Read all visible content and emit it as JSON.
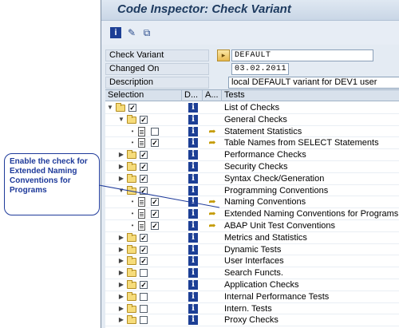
{
  "window": {
    "title": "Code Inspector: Check Variant"
  },
  "toolbar": [
    {
      "name": "info-icon",
      "glyph": "i"
    },
    {
      "name": "edit-pen-icon",
      "glyph": "✎"
    },
    {
      "name": "structure-icon",
      "glyph": "⧉"
    }
  ],
  "form": {
    "check_variant_label": "Check Variant",
    "check_variant_value": "DEFAULT",
    "changed_on_label": "Changed On",
    "changed_on_value": "03.02.2011",
    "description_label": "Description",
    "description_value": "local DEFAULT variant for DEV1 user"
  },
  "columns": {
    "selection": "Selection",
    "d": "D...",
    "a": "A...",
    "tests": "Tests"
  },
  "tree": [
    {
      "label": "List of Checks",
      "level": 0,
      "type": "folder",
      "checked": true,
      "expander": "▼",
      "run": false
    },
    {
      "label": "General Checks",
      "level": 1,
      "type": "folder-open",
      "checked": true,
      "expander": "▼",
      "run": false
    },
    {
      "label": "Statement Statistics",
      "level": 2,
      "type": "doc",
      "checked": false,
      "expander": "•",
      "run": true
    },
    {
      "label": "Table Names from SELECT Statements",
      "level": 2,
      "type": "doc",
      "checked": true,
      "expander": "•",
      "run": true
    },
    {
      "label": "Performance Checks",
      "level": 1,
      "type": "folder",
      "checked": true,
      "expander": "▶",
      "run": false
    },
    {
      "label": "Security Checks",
      "level": 1,
      "type": "folder",
      "checked": true,
      "expander": "▶",
      "run": false
    },
    {
      "label": "Syntax Check/Generation",
      "level": 1,
      "type": "folder",
      "checked": true,
      "expander": "▶",
      "run": false
    },
    {
      "label": "Programming Conventions",
      "level": 1,
      "type": "folder",
      "checked": true,
      "expander": "▼",
      "run": false
    },
    {
      "label": "Naming Conventions",
      "level": 2,
      "type": "doc",
      "checked": true,
      "expander": "•",
      "run": true
    },
    {
      "label": "Extended Naming Conventions for Programs",
      "level": 2,
      "type": "doc",
      "checked": true,
      "expander": "•",
      "run": true
    },
    {
      "label": "ABAP Unit Test Conventions",
      "level": 2,
      "type": "doc",
      "checked": true,
      "expander": "•",
      "run": true
    },
    {
      "label": "Metrics and Statistics",
      "level": 1,
      "type": "folder",
      "checked": true,
      "expander": "▶",
      "run": false
    },
    {
      "label": "Dynamic Tests",
      "level": 1,
      "type": "folder",
      "checked": true,
      "expander": "▶",
      "run": false
    },
    {
      "label": "User Interfaces",
      "level": 1,
      "type": "folder",
      "checked": true,
      "expander": "▶",
      "run": false
    },
    {
      "label": "Search Functs.",
      "level": 1,
      "type": "folder",
      "checked": false,
      "expander": "▶",
      "run": false
    },
    {
      "label": "Application Checks",
      "level": 1,
      "type": "folder",
      "checked": true,
      "expander": "▶",
      "run": false
    },
    {
      "label": "Internal Performance Tests",
      "level": 1,
      "type": "folder",
      "checked": false,
      "expander": "▶",
      "run": false
    },
    {
      "label": "Intern. Tests",
      "level": 1,
      "type": "folder",
      "checked": false,
      "expander": "▶",
      "run": false
    },
    {
      "label": "Proxy Checks",
      "level": 1,
      "type": "folder",
      "checked": false,
      "expander": "▶",
      "run": false
    }
  ],
  "callout": {
    "text": "Enable the check for Extended Naming Conventions for Programs"
  },
  "colors": {
    "accent": "#1e3a9a",
    "title": "#1d3a5f",
    "info": "#1d3f95",
    "folder": "#f6dc7b"
  }
}
